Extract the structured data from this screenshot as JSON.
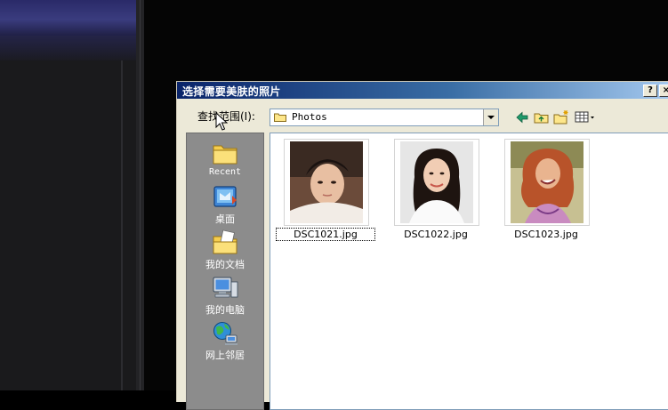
{
  "dialog": {
    "title": "选择需要美肤的照片",
    "help_button": "?",
    "close_button": "×"
  },
  "look_in": {
    "label": "查找范围(I):",
    "value": "Photos"
  },
  "toolbar": {
    "icons": [
      "back-arrow-icon",
      "up-folder-icon",
      "new-folder-icon",
      "view-menu-icon"
    ]
  },
  "places": [
    {
      "label": "Recent",
      "icon": "recent-folder-icon"
    },
    {
      "label": "桌面",
      "icon": "desktop-icon"
    },
    {
      "label": "我的文档",
      "icon": "my-documents-icon"
    },
    {
      "label": "我的电脑",
      "icon": "my-computer-icon"
    },
    {
      "label": "网上邻居",
      "icon": "network-places-icon"
    }
  ],
  "files": [
    {
      "name": "DSC1021.jpg",
      "selected": true
    },
    {
      "name": "DSC1022.jpg",
      "selected": false
    },
    {
      "name": "DSC1023.jpg",
      "selected": false
    }
  ],
  "colors": {
    "title_gradient_start": "#0a246a",
    "title_gradient_end": "#a6caf0",
    "dialog_face": "#ece9d8",
    "places_bar": "#8c8c8c"
  }
}
